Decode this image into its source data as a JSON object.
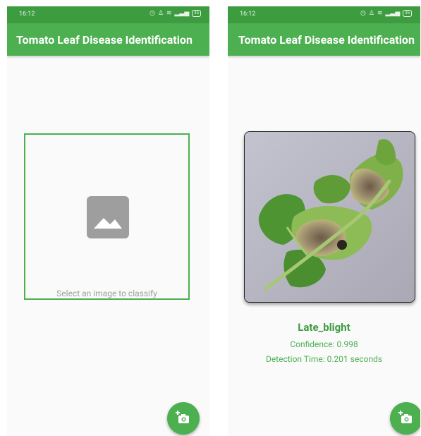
{
  "left_screen": {
    "status": {
      "time": "16:12",
      "battery": "35"
    },
    "appbar": {
      "title": "Tomato Leaf Disease Identification"
    },
    "picker": {
      "hint": "Select an image to classify",
      "icon": "image-placeholder-icon"
    },
    "fab": {
      "icon": "add-photo-icon"
    }
  },
  "right_screen": {
    "status": {
      "time": "16:12",
      "battery": "35"
    },
    "appbar": {
      "title": "Tomato Leaf Disease Identification"
    },
    "result": {
      "label": "Late_blight",
      "confidence": "Confidence: 0.998",
      "detection_time": "Detection Time: 0.201 seconds"
    },
    "fab": {
      "icon": "add-photo-icon"
    }
  },
  "colors": {
    "primary": "#4caf50",
    "status_bar": "#3d9c40",
    "placeholder": "#9e9e9e"
  }
}
